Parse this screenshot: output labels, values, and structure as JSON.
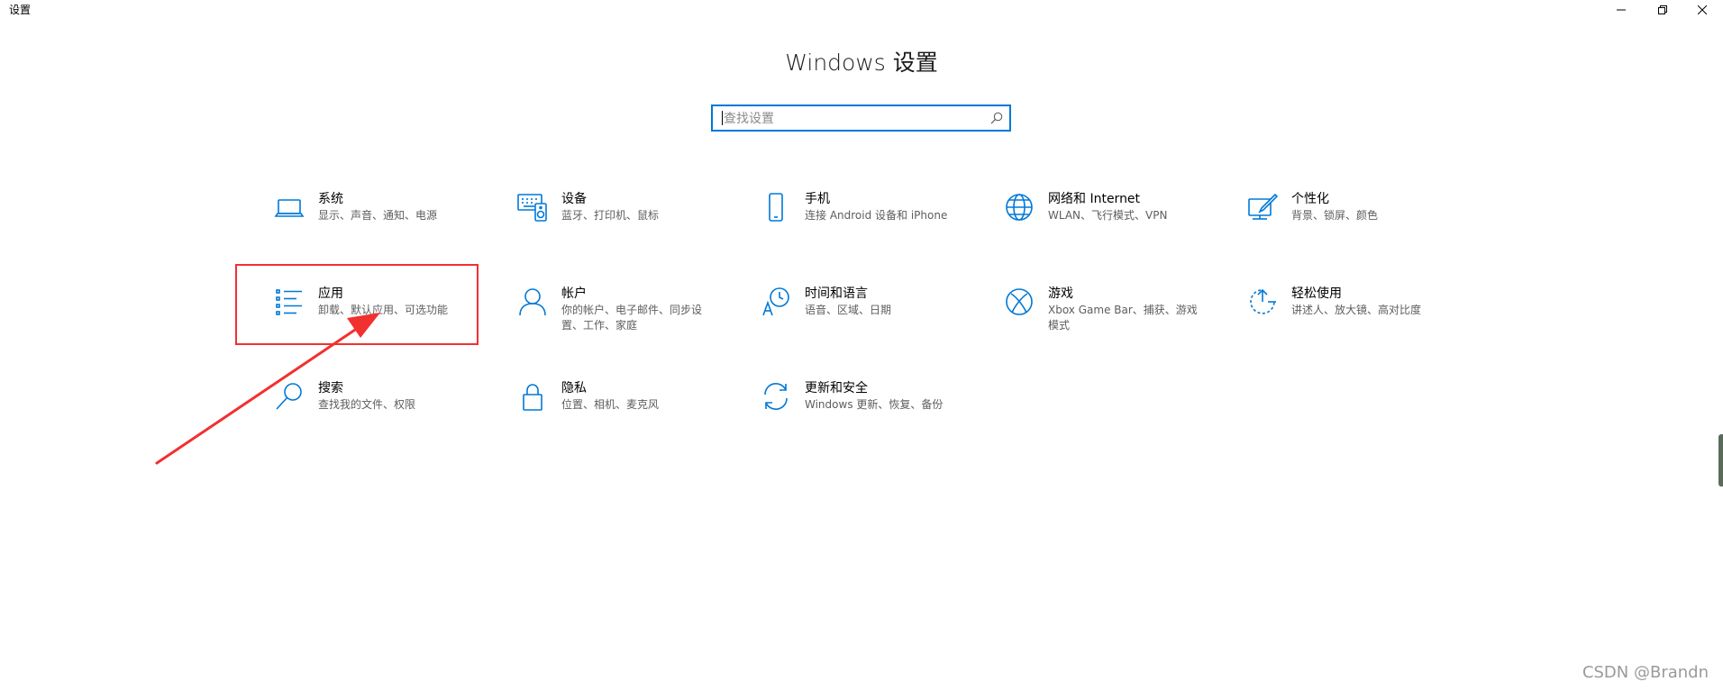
{
  "window": {
    "title": "设置"
  },
  "page": {
    "title": "Windows 设置"
  },
  "search": {
    "placeholder": "查找设置",
    "value": ""
  },
  "tiles": [
    {
      "label": "系统",
      "desc": "显示、声音、通知、电源",
      "icon": "laptop-icon"
    },
    {
      "label": "设备",
      "desc": "蓝牙、打印机、鼠标",
      "icon": "keyboard-speaker-icon"
    },
    {
      "label": "手机",
      "desc": "连接 Android 设备和 iPhone",
      "icon": "phone-icon"
    },
    {
      "label": "网络和 Internet",
      "desc": "WLAN、飞行模式、VPN",
      "icon": "globe-icon"
    },
    {
      "label": "个性化",
      "desc": "背景、锁屏、颜色",
      "icon": "paint-icon"
    },
    {
      "label": "应用",
      "desc": "卸载、默认应用、可选功能",
      "icon": "apps-list-icon"
    },
    {
      "label": "帐户",
      "desc": "你的帐户、电子邮件、同步设置、工作、家庭",
      "icon": "person-icon"
    },
    {
      "label": "时间和语言",
      "desc": "语音、区域、日期",
      "icon": "time-language-icon"
    },
    {
      "label": "游戏",
      "desc": "Xbox Game Bar、捕获、游戏模式",
      "icon": "xbox-icon"
    },
    {
      "label": "轻松使用",
      "desc": "讲述人、放大镜、高对比度",
      "icon": "ease-of-access-icon"
    },
    {
      "label": "搜索",
      "desc": "查找我的文件、权限",
      "icon": "search-icon"
    },
    {
      "label": "隐私",
      "desc": "位置、相机、麦克风",
      "icon": "lock-icon"
    },
    {
      "label": "更新和安全",
      "desc": "Windows 更新、恢复、备份",
      "icon": "update-icon"
    }
  ],
  "watermark": "CSDN @Brandn",
  "colors": {
    "accent": "#0078d7",
    "annotation": "#f23030"
  }
}
